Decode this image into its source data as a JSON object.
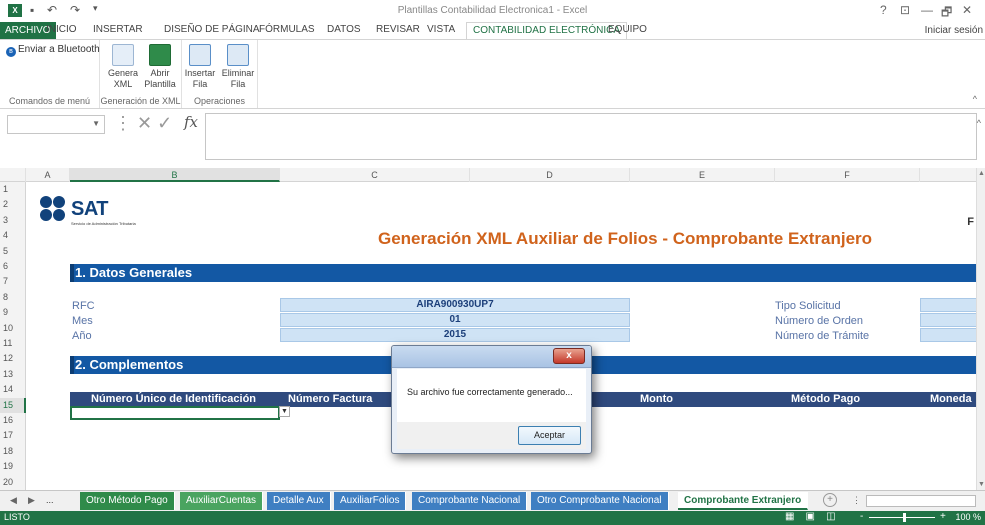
{
  "window": {
    "title": "Plantillas Contabilidad Electronica1 - Excel",
    "controls": [
      "?",
      "⊡",
      "—",
      "🗗",
      "✕"
    ]
  },
  "ribbon_tabs": [
    "ARCHIVO",
    "INICIO",
    "INSERTAR",
    "DISEÑO DE PÁGINA",
    "FÓRMULAS",
    "DATOS",
    "REVISAR",
    "VISTA",
    "CONTABILIDAD ELECTRÓNICA",
    "EQUIPO"
  ],
  "active_tab": "CONTABILIDAD ELECTRÓNICA",
  "signin": "Iniciar sesión",
  "ribbon": {
    "bluetooth": "Enviar a Bluetooth",
    "group1": "Comandos de menú",
    "genera_xml": [
      "Genera",
      "XML"
    ],
    "abrir_plantilla": [
      "Abrir",
      "Plantilla"
    ],
    "group2": "Generación de XML",
    "insertar_fila": [
      "Insertar",
      "Fila"
    ],
    "eliminar_fila": [
      "Eliminar",
      "Fila"
    ],
    "group3": "Operaciones"
  },
  "formula_bar": {
    "name_box": "",
    "formula": "",
    "fx": "fx"
  },
  "columns": [
    "A",
    "B",
    "C",
    "D",
    "E",
    "F"
  ],
  "selected_column": "B",
  "rows": [
    "1",
    "2",
    "3",
    "4",
    "5",
    "6",
    "7",
    "8",
    "9",
    "10",
    "11",
    "12",
    "13",
    "14",
    "15",
    "16",
    "17",
    "18",
    "19",
    "20"
  ],
  "selected_row": "15",
  "sheet": {
    "logo_word": "SAT",
    "logo_sub": "Servicio de Administración Tributaria",
    "title": "Generación XML Auxiliar de Folios - Comprobante Extranjero",
    "corner_letter": "F",
    "section1": "1. Datos Generales",
    "rfc_label": "RFC",
    "rfc_value": "AIRA900930UP7",
    "mes_label": "Mes",
    "mes_value": "01",
    "anio_label": "Año",
    "anio_value": "2015",
    "tipo_solicitud": "Tipo Solicitud",
    "numero_orden": "Número de Orden",
    "numero_tramite": "Número de Trámite",
    "section2": "2. Complementos",
    "headers": [
      "Número Único de Identificación",
      "Número Factura",
      "Monto",
      "Método Pago",
      "Moneda"
    ]
  },
  "dialog": {
    "message": "Su archivo fue correctamente generado...",
    "ok": "Aceptar",
    "close": "x"
  },
  "sheet_tabs": [
    "Otro Método Pago",
    "AuxiliarCuentas",
    "Detalle Aux",
    "AuxiliarFolios",
    "Comprobante Nacional",
    "Otro Comprobante Nacional",
    "Comprobante Extranjero"
  ],
  "active_sheet": "Comprobante Extranjero",
  "status": {
    "ready": "LISTO",
    "zoom": "100 %"
  },
  "colors": {
    "excel_green": "#217346",
    "band_blue": "#1358a4",
    "title_orange": "#d0631c",
    "header_navy": "#2f4a7e"
  }
}
